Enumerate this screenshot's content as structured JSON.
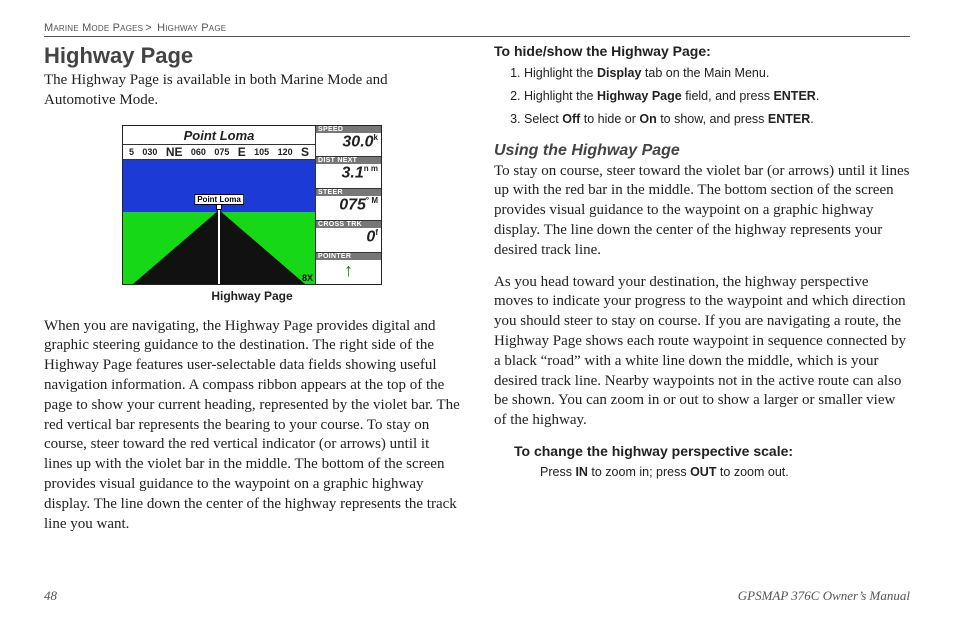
{
  "breadcrumb": {
    "a": "Marine Mode Pages",
    "sep": ">",
    "b": "Highway Page"
  },
  "left": {
    "title": "Highway Page",
    "intro": "The Highway Page is available in both Marine Mode and Automotive Mode.",
    "figure": {
      "title": "Point Loma",
      "compass": [
        "5",
        "030",
        "NE",
        "060",
        "075",
        "E",
        "105",
        "120",
        "S"
      ],
      "waypoint_label": "Point Loma",
      "zoom": "8X",
      "cells": [
        {
          "label": "SPEED",
          "value": "30.0",
          "unit": "k"
        },
        {
          "label": "DIST NEXT",
          "value": "3.1",
          "unit": "n m"
        },
        {
          "label": "STEER",
          "value": "075",
          "unit": "° M"
        },
        {
          "label": "CROSS TRK",
          "value": "0",
          "unit": "f"
        },
        {
          "label": "POINTER",
          "value": "",
          "unit": ""
        }
      ],
      "caption": "Highway Page"
    },
    "para": "When you are navigating, the Highway Page provides digital and graphic steering guidance to the destination. The right side of the Highway Page features user-selectable data fields showing useful navigation information. A compass ribbon appears at the top of the page to show your current heading, represented by the violet bar. The red vertical bar represents the bearing to your course. To stay on course, steer toward the red vertical indicator (or arrows) until it lines up with the violet bar in the middle. The bottom of the screen provides visual guidance to the waypoint on a graphic highway display. The line down the center of the highway represents the track line you want."
  },
  "right": {
    "proc1_head": "To hide/show the Highway Page:",
    "proc1_items": [
      {
        "pre": "Highlight the ",
        "b1": "Display",
        "post": " tab on the Main Menu."
      },
      {
        "pre": "Highlight the ",
        "b1": "Highway Page",
        "mid": " field, and press ",
        "b2": "ENTER",
        "post": "."
      },
      {
        "pre": "Select ",
        "b1": "Off",
        "mid": " to hide or ",
        "b2": "On",
        "mid2": " to show, and press ",
        "b3": "ENTER",
        "post": "."
      }
    ],
    "subhead": "Using the Highway Page",
    "para1": "To stay on course, steer toward the violet bar (or arrows) until it lines up with the red bar in the middle. The bottom section of the screen provides visual guidance to the waypoint on a graphic highway display. The line down the center of the highway represents your desired track line.",
    "para2": "As you head toward your destination, the highway perspective moves to indicate your progress to the waypoint and which direction you should steer to stay on course. If you are navigating a route, the Highway Page shows each route waypoint in sequence connected by a black “road” with a white line down the middle, which is your desired track line. Nearby waypoints not in the active route can also be shown. You can zoom in or out to show a larger or smaller view of the highway.",
    "proc2_head": "To change the highway perspective scale:",
    "proc2_line": {
      "pre": "Press ",
      "b1": "IN",
      "mid": " to zoom in; press ",
      "b2": "OUT",
      "post": " to zoom out."
    }
  },
  "footer": {
    "page": "48",
    "manual": "GPSMAP 376C Owner’s Manual"
  }
}
